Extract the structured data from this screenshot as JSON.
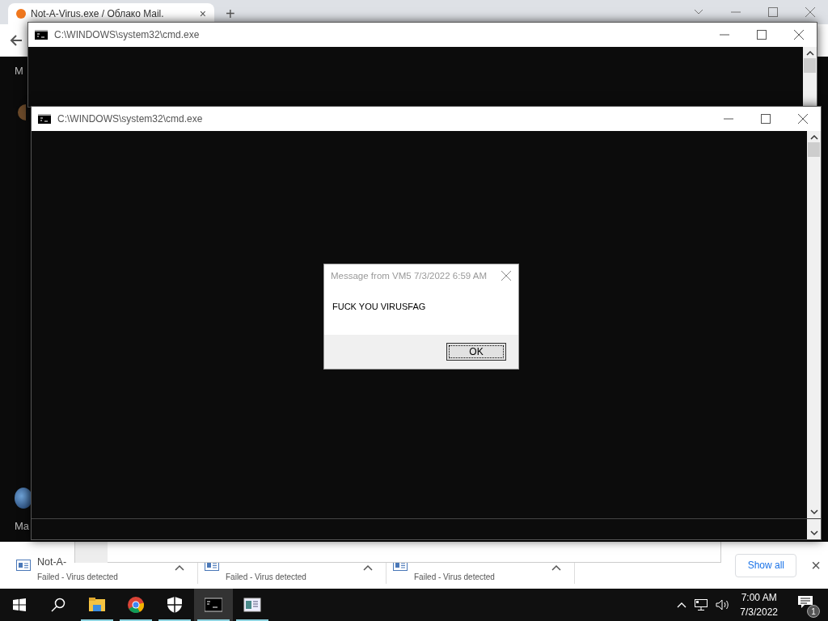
{
  "browser": {
    "tab": {
      "title": "Not-A-Virus.exe / Облако Mail.",
      "close": "×"
    },
    "new_tab": "+",
    "page_texts": [
      "M",
      "Ma"
    ]
  },
  "windows": [
    {
      "title": "C:\\WINDOWS\\system32\\cmd.exe"
    },
    {
      "title": "C:\\WINDOWS\\system32\\cmd.exe"
    }
  ],
  "dialog": {
    "title": "Message from VM5 7/3/2022 6:59 AM",
    "message": "FUCK YOU VIRUSFAG",
    "button": "OK"
  },
  "downloads": {
    "items": [
      {
        "name": "Not-A-",
        "status": "Failed - Virus detected"
      },
      {
        "status": "Failed - Virus detected"
      },
      {
        "status": "Failed - Virus detected"
      }
    ],
    "show_all": "Show all",
    "close": "×"
  },
  "taskbar": {
    "apps": [
      {
        "kind": "explorer",
        "running": true,
        "selected": false
      },
      {
        "kind": "chrome",
        "running": true,
        "selected": false
      },
      {
        "kind": "shield",
        "running": true,
        "selected": false
      },
      {
        "kind": "terminal",
        "running": true,
        "selected": true
      },
      {
        "kind": "document",
        "running": true,
        "selected": false
      }
    ],
    "clock": {
      "time": "7:00 AM",
      "date": "7/3/2022"
    },
    "notifications": "1"
  }
}
